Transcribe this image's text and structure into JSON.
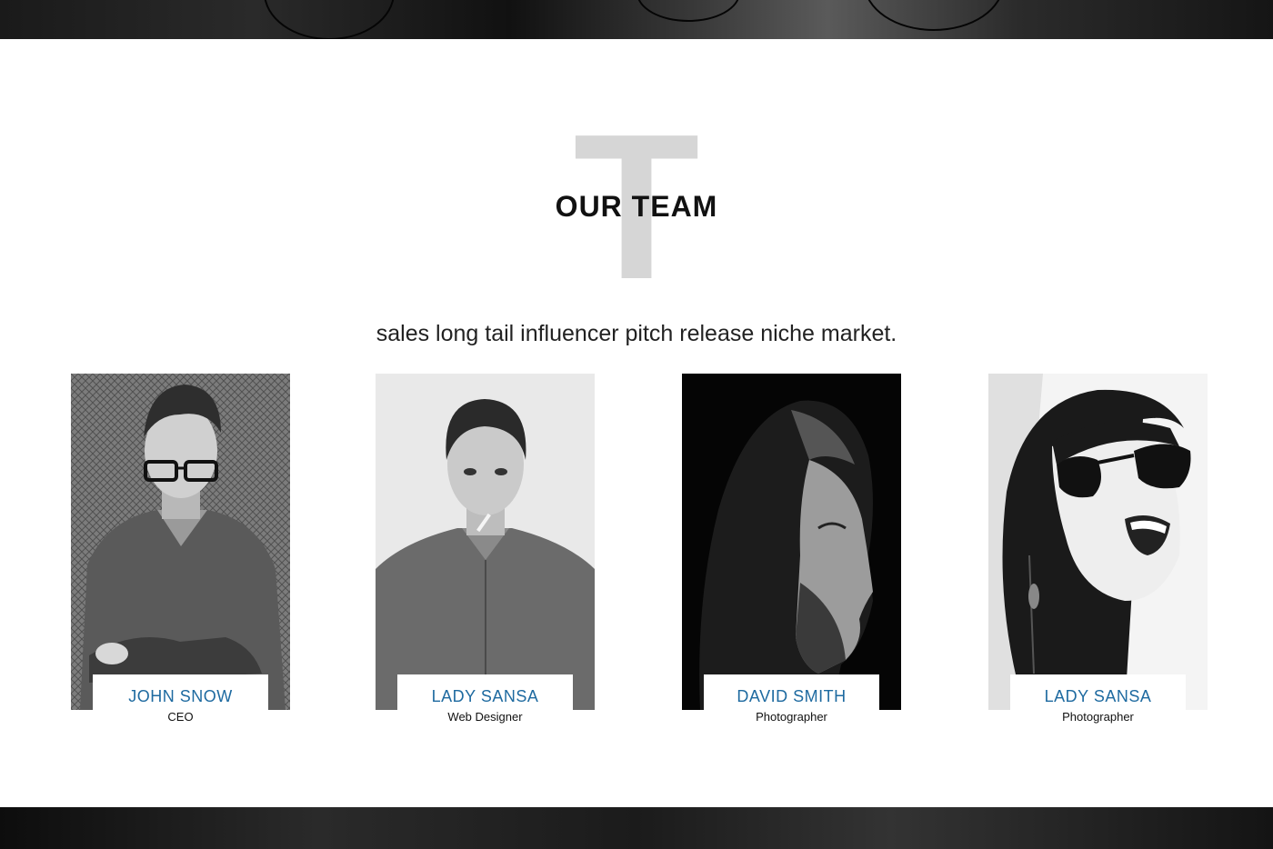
{
  "team_section": {
    "decorative_letter": "T",
    "title": "OUR TEAM",
    "subtitle": "sales long tail influencer pitch release niche market."
  },
  "members": [
    {
      "name": "JOHN SNOW",
      "role": "CEO"
    },
    {
      "name": "LADY SANSA",
      "role": "Web Designer"
    },
    {
      "name": "DAVID SMITH",
      "role": "Photographer"
    },
    {
      "name": "LADY SANSA",
      "role": "Photographer"
    }
  ],
  "colors": {
    "name_accent": "#1e6aa0",
    "decorative_letter": "#d6d6d6",
    "title": "#111111"
  }
}
